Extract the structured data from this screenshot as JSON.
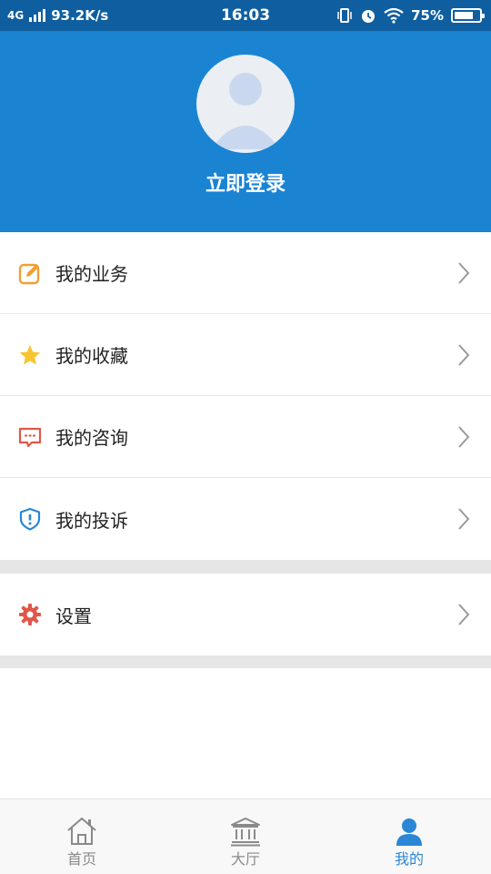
{
  "status_bar": {
    "network": "4G",
    "speed": "93.2K/s",
    "time": "16:03",
    "battery_percent": "75%",
    "battery_level": 0.75
  },
  "header": {
    "login_label": "立即登录"
  },
  "menu": {
    "items": [
      {
        "label": "我的业务",
        "icon": "edit-icon"
      },
      {
        "label": "我的收藏",
        "icon": "star-icon"
      },
      {
        "label": "我的咨询",
        "icon": "chat-icon"
      },
      {
        "label": "我的投诉",
        "icon": "shield-alert-icon"
      }
    ],
    "settings": {
      "label": "设置",
      "icon": "gear-icon"
    }
  },
  "bottom_nav": {
    "items": [
      {
        "label": "首页",
        "icon": "home-icon",
        "active": false
      },
      {
        "label": "大厅",
        "icon": "hall-icon",
        "active": false
      },
      {
        "label": "我的",
        "icon": "user-icon",
        "active": true
      }
    ]
  },
  "colors": {
    "header_bg": "#1a84d3",
    "status_bg": "#0f5fa0",
    "active_nav": "#2b86d6",
    "orange": "#f0a030",
    "star": "#f7c531",
    "red": "#e0574a",
    "blue": "#2b86d6"
  }
}
